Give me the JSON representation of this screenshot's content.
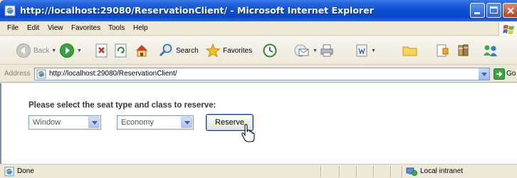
{
  "window": {
    "title": "http://localhost:29080/ReservationClient/ - Microsoft Internet Explorer"
  },
  "menu": [
    "File",
    "Edit",
    "View",
    "Favorites",
    "Tools",
    "Help"
  ],
  "toolbar": {
    "back_label": "Back",
    "search_label": "Search",
    "favorites_label": "Favorites"
  },
  "address": {
    "label": "Address",
    "url": "http://localhost:29080/ReservationClient/",
    "go_label": "Go"
  },
  "form": {
    "prompt": "Please select the seat type and class to reserve:",
    "seat_type": "Window",
    "seat_class": "Economy",
    "reserve_label": "Reserve"
  },
  "status": {
    "text": "Done",
    "zone": "Local intranet"
  },
  "colors": {
    "titlebar": "#0a4fd4",
    "chrome": "#ece9d8",
    "control_border": "#7f9db9",
    "button_border": "#1c3c8c"
  }
}
